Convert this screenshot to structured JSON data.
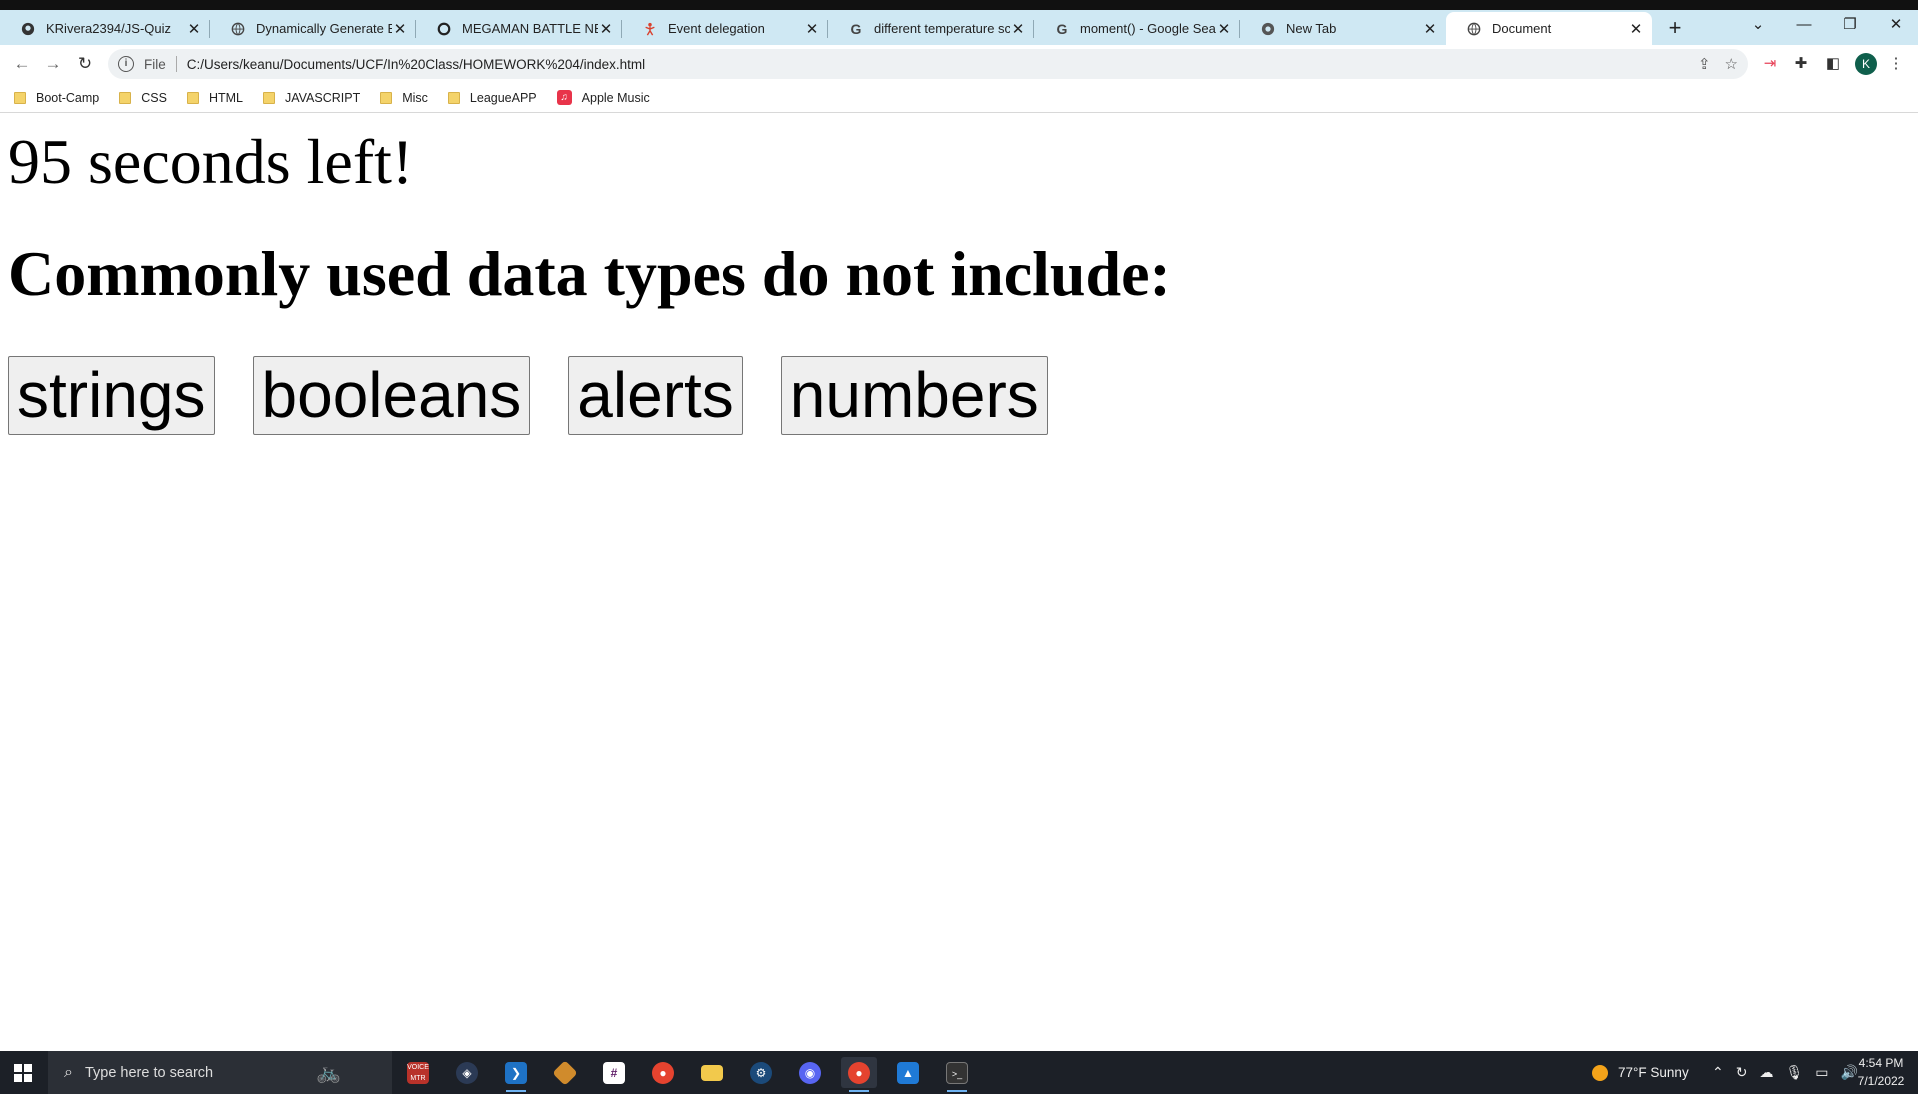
{
  "browser": {
    "tabs": [
      {
        "title": "KRivera2394/JS-Quiz",
        "icon": "github-icon",
        "active": false
      },
      {
        "title": "Dynamically Generate Elem",
        "icon": "globe-icon",
        "active": false
      },
      {
        "title": "MEGAMAN BATTLE NETWO",
        "icon": "site-icon",
        "active": false
      },
      {
        "title": "Event delegation",
        "icon": "person-icon",
        "active": false
      },
      {
        "title": "different temperature scale",
        "icon": "google-icon",
        "active": false
      },
      {
        "title": "moment() - Google Search",
        "icon": "google-icon",
        "active": false
      },
      {
        "title": "New Tab",
        "icon": "chrome-icon",
        "active": false
      },
      {
        "title": "Document",
        "icon": "globe-icon",
        "active": true
      }
    ],
    "address": {
      "scheme_label": "File",
      "url": "C:/Users/keanu/Documents/UCF/In%20Class/HOMEWORK%204/index.html"
    },
    "profile_initial": "K",
    "bookmarks": [
      {
        "label": "Boot-Camp",
        "type": "folder"
      },
      {
        "label": "CSS",
        "type": "folder"
      },
      {
        "label": "HTML",
        "type": "folder"
      },
      {
        "label": "JAVASCRIPT",
        "type": "folder"
      },
      {
        "label": "Misc",
        "type": "folder"
      },
      {
        "label": "LeagueAPP",
        "type": "folder"
      },
      {
        "label": "Apple Music",
        "type": "music"
      }
    ]
  },
  "page": {
    "timer_text": "95 seconds left!",
    "question": "Commonly used data types do not include:",
    "answers": [
      "strings",
      "booleans",
      "alerts",
      "numbers"
    ]
  },
  "taskbar": {
    "search_placeholder": "Type here to search",
    "weather": "77°F  Sunny",
    "time": "4:54 PM",
    "date": "7/1/2022"
  }
}
